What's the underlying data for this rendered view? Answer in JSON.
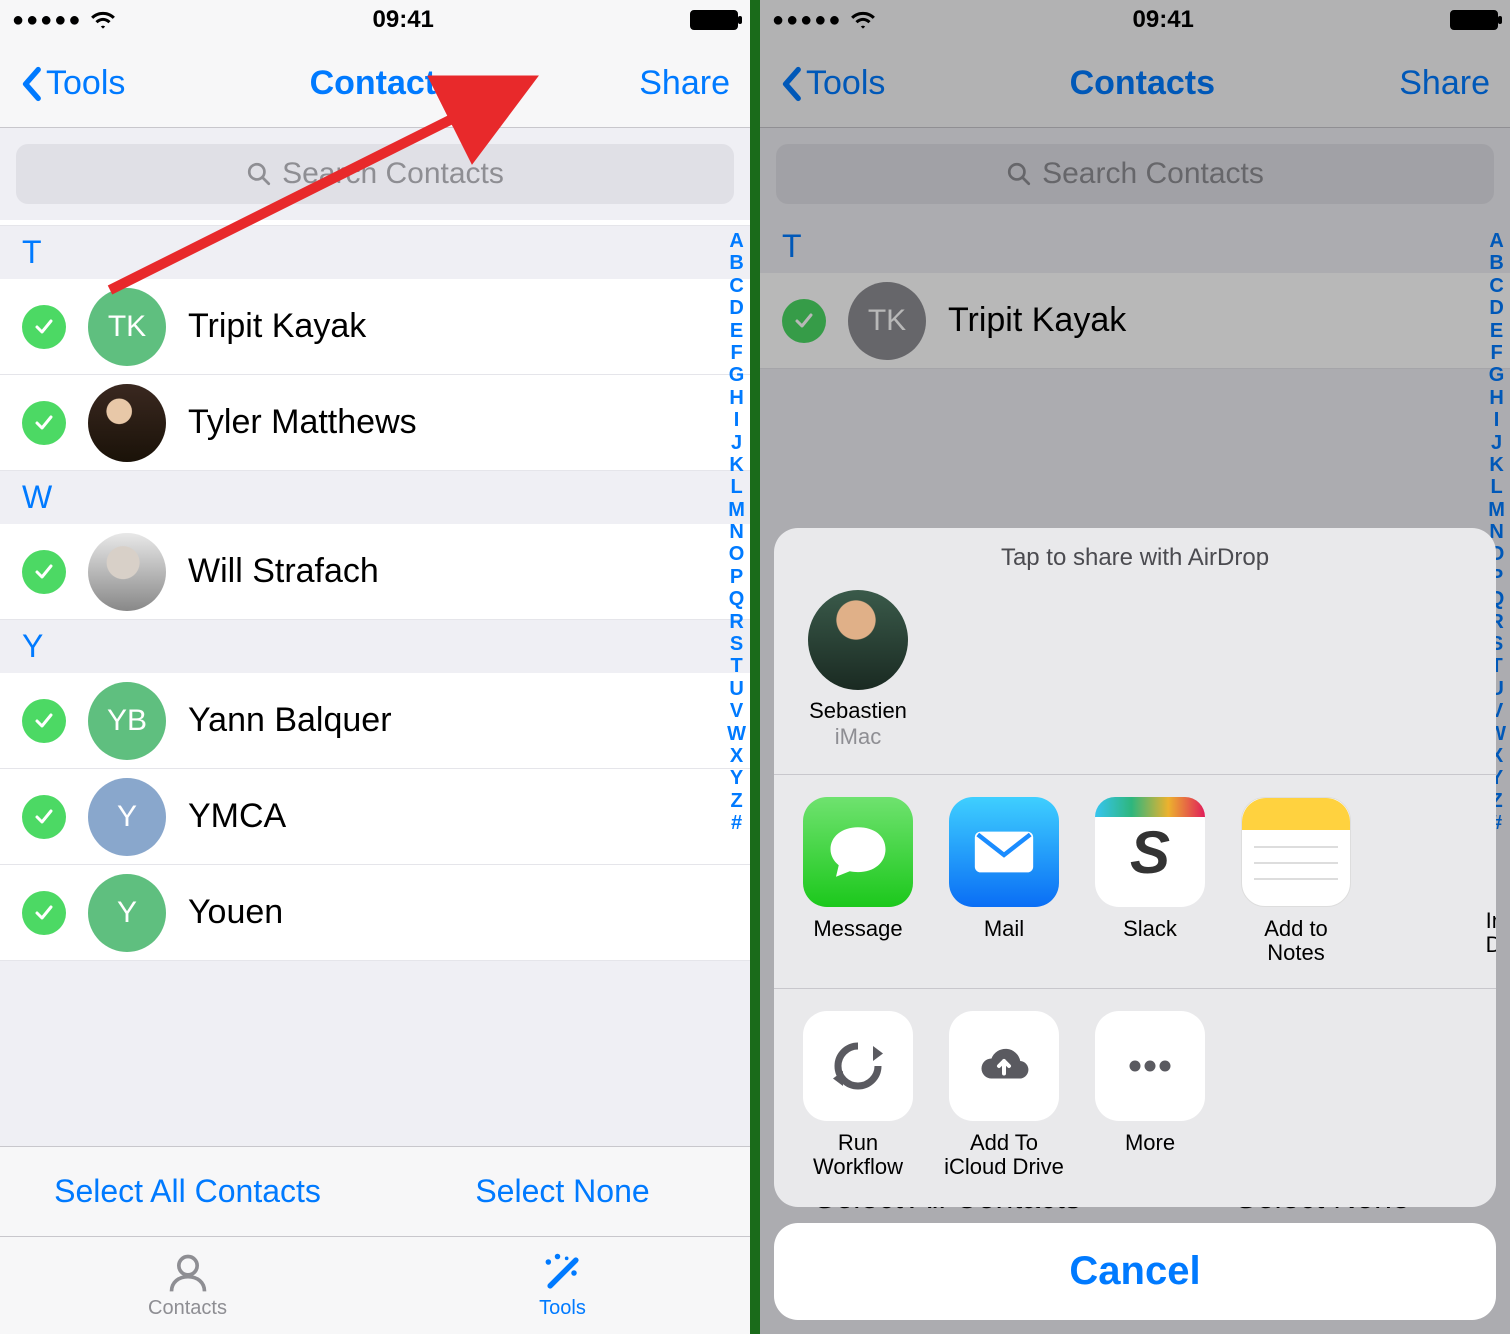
{
  "status": {
    "time": "09:41"
  },
  "nav": {
    "back": "Tools",
    "title": "Contacts",
    "share": "Share"
  },
  "search": {
    "placeholder": "Search Contacts"
  },
  "index_letters": [
    "A",
    "B",
    "C",
    "D",
    "E",
    "F",
    "G",
    "H",
    "I",
    "J",
    "K",
    "L",
    "M",
    "N",
    "O",
    "P",
    "Q",
    "R",
    "S",
    "T",
    "U",
    "V",
    "W",
    "X",
    "Y",
    "Z",
    "#"
  ],
  "sections": [
    {
      "letter": "T",
      "contacts": [
        {
          "initials": "TK",
          "name": "Tripit Kayak",
          "avatar": "green"
        },
        {
          "initials": "",
          "name": "Tyler Matthews",
          "avatar": "photo1"
        }
      ]
    },
    {
      "letter": "W",
      "contacts": [
        {
          "initials": "",
          "name": "Will Strafach",
          "avatar": "photo2"
        }
      ]
    },
    {
      "letter": "Y",
      "contacts": [
        {
          "initials": "YB",
          "name": "Yann Balquer",
          "avatar": "green"
        },
        {
          "initials": "Y",
          "name": "YMCA",
          "avatar": "blue"
        },
        {
          "initials": "Y",
          "name": "Youen",
          "avatar": "green"
        }
      ]
    }
  ],
  "toolbar": {
    "select_all": "Select All Contacts",
    "select_none": "Select None"
  },
  "tabs": {
    "contacts": "Contacts",
    "tools": "Tools"
  },
  "share_sheet": {
    "header": "Tap to share with AirDrop",
    "airdrop": {
      "name": "Sebastien",
      "sub": "iMac"
    },
    "apps": [
      {
        "label": "Message",
        "id": "message"
      },
      {
        "label": "Mail",
        "id": "mail"
      },
      {
        "label": "Slack",
        "id": "slack"
      },
      {
        "label": "Add to Notes",
        "id": "notes"
      }
    ],
    "actions": [
      {
        "label": "Run\nWorkflow",
        "id": "workflow"
      },
      {
        "label": "Add To\niCloud Drive",
        "id": "icloud"
      },
      {
        "label": "More",
        "id": "more"
      }
    ],
    "cancel": "Cancel",
    "partial": "In\nD"
  }
}
